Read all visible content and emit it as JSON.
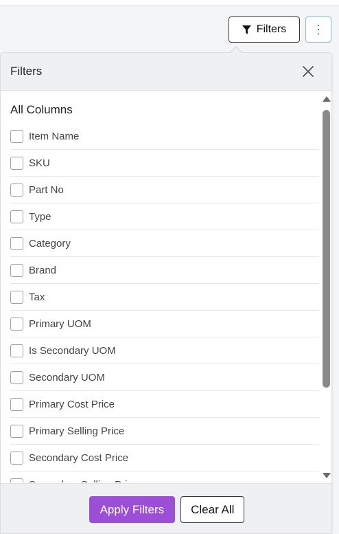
{
  "toolbar": {
    "filters_label": "Filters",
    "filter_icon": "funnel-icon",
    "more_icon": "vertical-ellipsis-icon",
    "more_glyph": "⋮"
  },
  "popover": {
    "title": "Filters",
    "close_icon": "close-icon",
    "section_title": "All Columns",
    "columns": [
      {
        "label": "Item Name",
        "checked": false
      },
      {
        "label": "SKU",
        "checked": false
      },
      {
        "label": "Part No",
        "checked": false
      },
      {
        "label": "Type",
        "checked": false
      },
      {
        "label": "Category",
        "checked": false
      },
      {
        "label": "Brand",
        "checked": false
      },
      {
        "label": "Tax",
        "checked": false
      },
      {
        "label": "Primary UOM",
        "checked": false
      },
      {
        "label": "Is Secondary UOM",
        "checked": false
      },
      {
        "label": "Secondary UOM",
        "checked": false
      },
      {
        "label": "Primary Cost Price",
        "checked": false
      },
      {
        "label": "Primary Selling Price",
        "checked": false
      },
      {
        "label": "Secondary Cost Price",
        "checked": false
      },
      {
        "label": "Secondary Selling Price",
        "checked": false
      }
    ],
    "apply_label": "Apply Filters",
    "clear_label": "Clear All"
  },
  "colors": {
    "accent": "#9c4fd6",
    "header_bg": "#eff0f1",
    "kebab_border": "#8fb7d6"
  }
}
